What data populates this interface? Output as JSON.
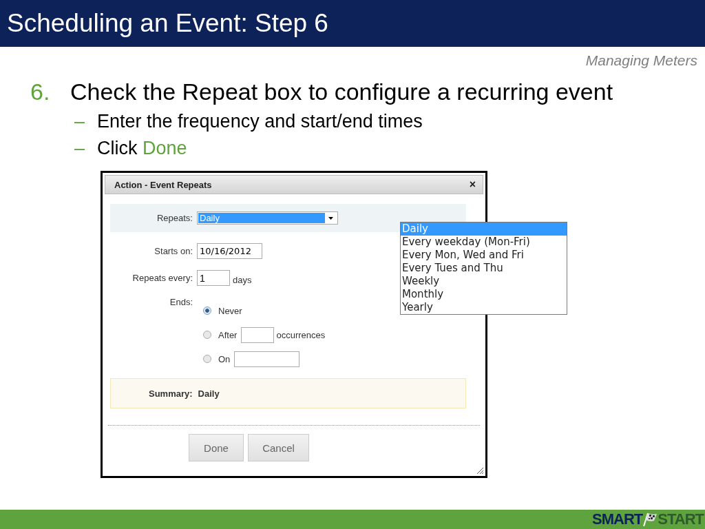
{
  "title": "Scheduling an Event: Step 6",
  "section": "Managing Meters",
  "step": {
    "number": "6.",
    "text": "Check the Repeat box to configure a recurring event"
  },
  "substeps": [
    {
      "marker": "–",
      "text": "Enter the frequency and start/end times"
    },
    {
      "marker": "–",
      "text": "Click",
      "highlight": "Done"
    }
  ],
  "dialog": {
    "title": "Action - Event Repeats",
    "close": "×",
    "repeats": {
      "label": "Repeats:",
      "value": "Daily"
    },
    "starts_on": {
      "label": "Starts on:",
      "value": "10/16/2012"
    },
    "repeats_every": {
      "label": "Repeats every:",
      "value": "1",
      "unit": "days"
    },
    "ends": {
      "label": "Ends:",
      "options": [
        {
          "kind": "plain",
          "label": "Never",
          "selected": true
        },
        {
          "kind": "count",
          "label": "After",
          "unit": "occurrences",
          "selected": false
        },
        {
          "kind": "date",
          "label": "On",
          "selected": false
        }
      ]
    },
    "summary": {
      "label": "Summary:",
      "value": "Daily"
    },
    "buttons": [
      "Done",
      "Cancel"
    ]
  },
  "dropdown": [
    {
      "label": "Daily",
      "selected": true
    },
    {
      "label": "Every weekday (Mon-Fri)",
      "selected": false
    },
    {
      "label": "Every Mon, Wed and Fri",
      "selected": false
    },
    {
      "label": "Every Tues and Thu",
      "selected": false
    },
    {
      "label": "Weekly",
      "selected": false
    },
    {
      "label": "Monthly",
      "selected": false
    },
    {
      "label": "Yearly",
      "selected": false
    }
  ],
  "logo": {
    "left": "SMART",
    "right": "START"
  }
}
